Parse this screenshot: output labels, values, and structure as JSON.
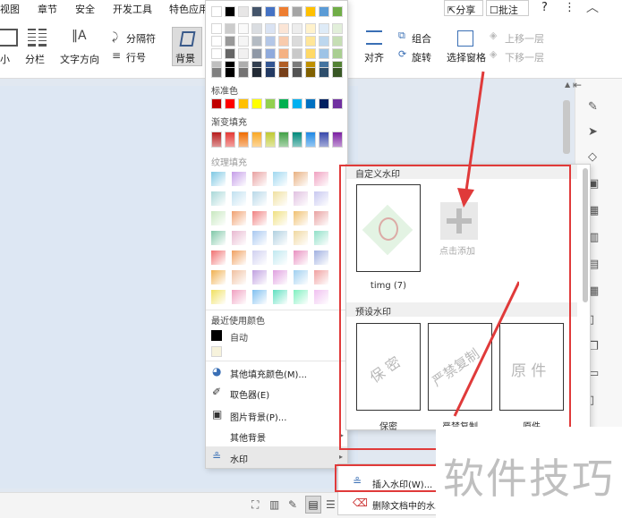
{
  "tabs": [
    "视图",
    "章节",
    "安全",
    "开发工具",
    "特色应用"
  ],
  "ribbon_left": {
    "btn_small": "小",
    "btn_columns": "分栏",
    "btn_text_direction": "文字方向",
    "btn_separator": "分隔符",
    "btn_line_number": "行号",
    "btn_background": "背景"
  },
  "ribbon_right": {
    "align": "对齐",
    "group": "组合",
    "rotate": "旋转",
    "selection_pane": "选择窗格",
    "bring_forward": "上移一层",
    "send_backward": "下移一层"
  },
  "top_actions": {
    "share": "分享",
    "comment": "批注",
    "help": "?",
    "more": "⋮"
  },
  "color_panel": {
    "standard_label": "标准色",
    "gradient_label": "渐变填充",
    "texture_label": "纹理填充",
    "recent_label": "最近使用颜色",
    "auto_label": "自动",
    "more_fill": "其他填充颜色(M)...",
    "picker": "取色器(E)",
    "picture_bg": "图片背景(P)...",
    "other_bg": "其他背景",
    "watermark": "水印",
    "theme_colors": [
      "#ffffff",
      "#000000",
      "#e7e6e6",
      "#44546a",
      "#4472c4",
      "#ed7d31",
      "#a5a5a5",
      "#ffc000",
      "#5b9bd5",
      "#70ad47"
    ],
    "standard_colors": [
      "#c00000",
      "#ff0000",
      "#ffc000",
      "#ffff00",
      "#92d050",
      "#00b050",
      "#00b0f0",
      "#0070c0",
      "#002060",
      "#7030a0"
    ],
    "recent_colors": [
      "#000000",
      "#f7f3dc"
    ]
  },
  "watermark_panel": {
    "custom_header": "自定义水印",
    "custom_thumb_caption": "timg (7)",
    "add_label": "点击添加",
    "preset_header": "预设水印",
    "presets": [
      {
        "text": "保 密",
        "caption": "保密"
      },
      {
        "text": "严禁复制",
        "caption": "严禁复制"
      },
      {
        "text": "原 件",
        "caption": "原件"
      }
    ]
  },
  "submenu": {
    "insert": "插入水印(W)...",
    "delete": "删除文档中的水印"
  },
  "overlay_text": "软件技巧"
}
